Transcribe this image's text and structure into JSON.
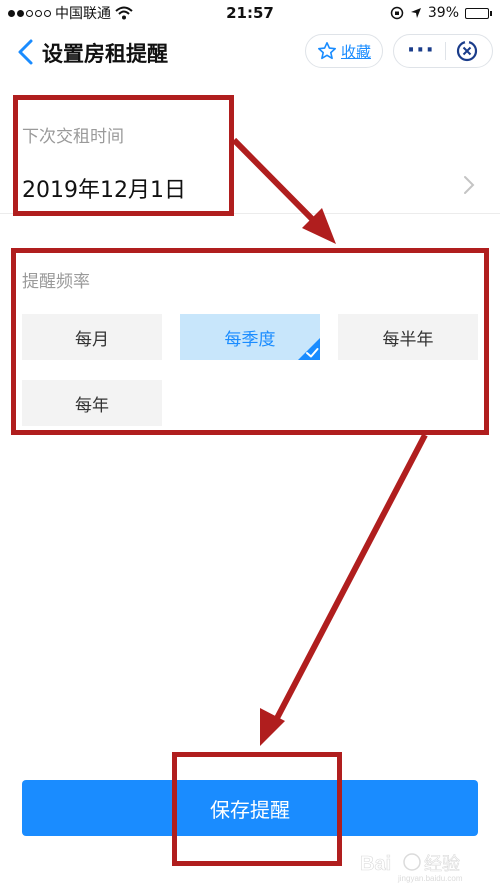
{
  "status_bar": {
    "carrier": "中国联通",
    "time": "21:57",
    "battery_percent": "39%",
    "battery_level": 0.39,
    "signal_dots_on": 2,
    "signal_dots_total": 5
  },
  "nav": {
    "title": "设置房租提醒",
    "favorite_label": "收藏"
  },
  "form": {
    "next_due_label": "下次交租时间",
    "next_due_value": "2019年12月1日",
    "frequency_label": "提醒频率",
    "frequency_options": [
      {
        "label": "每月",
        "selected": false
      },
      {
        "label": "每季度",
        "selected": true
      },
      {
        "label": "每半年",
        "selected": false
      },
      {
        "label": "每年",
        "selected": false
      }
    ],
    "save_label": "保存提醒"
  },
  "colors": {
    "accent": "#1a8cff",
    "selected_bg": "#c8e6fb",
    "annotation": "#b01e1e"
  }
}
